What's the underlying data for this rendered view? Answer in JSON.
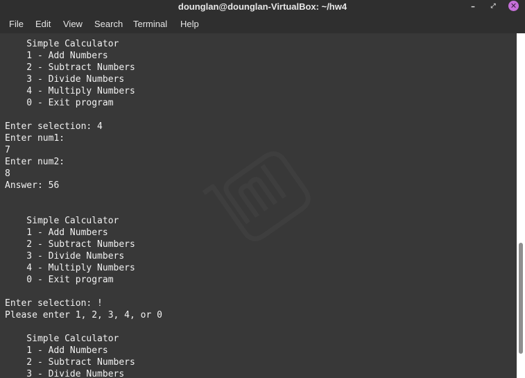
{
  "window": {
    "title": "dounglan@dounglan-VirtualBox: ~/hw4",
    "minimize_glyph": "–",
    "maximize_glyph": "⤢",
    "close_glyph": "✕"
  },
  "menubar": {
    "items": [
      "File",
      "Edit",
      "View",
      "Search",
      "Terminal",
      "Help"
    ]
  },
  "terminal": {
    "lines": [
      "    Simple Calculator",
      "    1 - Add Numbers",
      "    2 - Subtract Numbers",
      "    3 - Divide Numbers",
      "    4 - Multiply Numbers",
      "    0 - Exit program",
      "",
      "Enter selection: 4",
      "Enter num1:",
      "7",
      "Enter num2:",
      "8",
      "Answer: 56",
      "",
      "",
      "    Simple Calculator",
      "    1 - Add Numbers",
      "    2 - Subtract Numbers",
      "    3 - Divide Numbers",
      "    4 - Multiply Numbers",
      "    0 - Exit program",
      "",
      "Enter selection: !",
      "Please enter 1, 2, 3, 4, or 0",
      "",
      "    Simple Calculator",
      "    1 - Add Numbers",
      "    2 - Subtract Numbers",
      "    3 - Divide Numbers"
    ],
    "background_logo": "linux-mint-logo-icon"
  },
  "colors": {
    "titlebar": "#2f2f2f",
    "terminal_bg": "#383838",
    "text": "#f2f2f2",
    "close_button": "#c670d9"
  }
}
